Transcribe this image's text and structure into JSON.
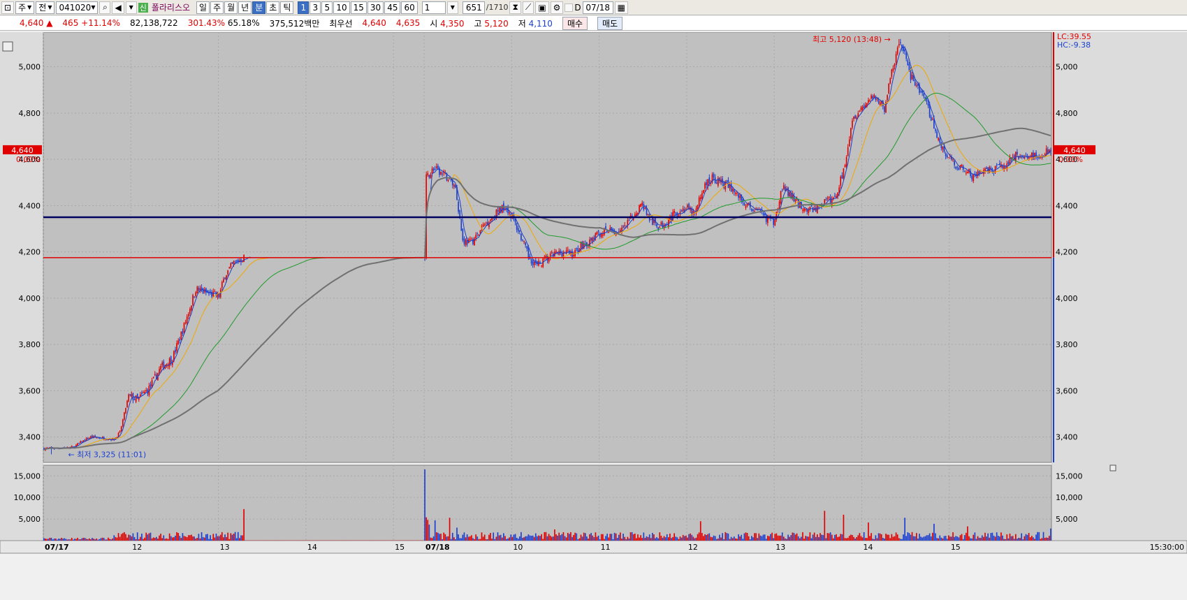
{
  "toolbar": {
    "type_label": "주",
    "all_label": "전",
    "code": "041020",
    "new_badge": "신",
    "stock_name": "폴라리스오",
    "periods": [
      "일",
      "주",
      "월",
      "년",
      "분",
      "초",
      "틱"
    ],
    "selected_period": "분",
    "intervals": [
      "1",
      "3",
      "5",
      "10",
      "15",
      "30",
      "45",
      "60"
    ],
    "selected_interval": "1",
    "interval_value": "1",
    "count": "651",
    "count_total": "/1710",
    "date_prefix": "D",
    "date": "07/18"
  },
  "quote": {
    "price": "4,640",
    "change": "465",
    "change_pct": "+11.14%",
    "volume": "82,138,722",
    "vol_ratio": "301.43%",
    "turnover": "65.18%",
    "amount": "375,512백만",
    "best_label": "최우선",
    "ask": "4,640",
    "bid": "4,635",
    "open_label": "시",
    "open": "4,350",
    "high_label": "고",
    "high": "5,120",
    "low_label": "저",
    "low": "4,110",
    "buy_label": "매수",
    "sell_label": "매도"
  },
  "colors": {
    "up": "#e10000",
    "down": "#1a3fd1",
    "ma5": "#1c3cc4",
    "ma20": "#f0a800",
    "ma60": "#1f9a2a",
    "ma120": "#707070",
    "navy_line": "#000060",
    "red_line": "#e00000",
    "plot_bg": "#c0c0c0"
  },
  "chart_data": {
    "type": "candlestick",
    "price_axis": {
      "min": 3290,
      "max": 5150,
      "ticks": [
        3400,
        3600,
        3800,
        4000,
        4200,
        4400,
        4600,
        4800,
        5000
      ],
      "tick_labels": [
        "3,400",
        "3,600",
        "3,800",
        "4,000",
        "4,200",
        "4,400",
        "4,600",
        "4,800",
        "5,000"
      ]
    },
    "volume_axis": {
      "min": 0,
      "max": 16500,
      "ticks": [
        5000,
        10000,
        15000
      ],
      "tick_labels": [
        "5,000",
        "10,000",
        "15,000"
      ]
    },
    "time_labels": [
      {
        "idx": 0,
        "text": "07/17"
      },
      {
        "idx": 60,
        "text": "12"
      },
      {
        "idx": 120,
        "text": "13"
      },
      {
        "idx": 180,
        "text": "14"
      },
      {
        "idx": 240,
        "text": "15"
      },
      {
        "idx": 261,
        "text": "07/18"
      },
      {
        "idx": 321,
        "text": "10"
      },
      {
        "idx": 381,
        "text": "11"
      },
      {
        "idx": 441,
        "text": "12"
      },
      {
        "idx": 501,
        "text": "13"
      },
      {
        "idx": 561,
        "text": "14"
      },
      {
        "idx": 621,
        "text": "15"
      }
    ],
    "end_time_label": "15:30:00",
    "keypoints": [
      [
        0,
        3350
      ],
      [
        20,
        3355
      ],
      [
        26,
        3380
      ],
      [
        32,
        3400
      ],
      [
        48,
        3390
      ],
      [
        52,
        3420
      ],
      [
        58,
        3580
      ],
      [
        64,
        3560
      ],
      [
        72,
        3610
      ],
      [
        80,
        3700
      ],
      [
        88,
        3740
      ],
      [
        96,
        3880
      ],
      [
        104,
        4040
      ],
      [
        112,
        4020
      ],
      [
        120,
        4010
      ],
      [
        124,
        4100
      ],
      [
        130,
        4150
      ],
      [
        137,
        4175
      ],
      [
        261,
        4175
      ],
      [
        262,
        4520
      ],
      [
        267,
        4560
      ],
      [
        272,
        4540
      ],
      [
        277,
        4520
      ],
      [
        282,
        4480
      ],
      [
        287,
        4250
      ],
      [
        292,
        4240
      ],
      [
        297,
        4270
      ],
      [
        302,
        4320
      ],
      [
        307,
        4350
      ],
      [
        312,
        4380
      ],
      [
        316,
        4400
      ],
      [
        320,
        4360
      ],
      [
        326,
        4280
      ],
      [
        332,
        4180
      ],
      [
        338,
        4140
      ],
      [
        344,
        4170
      ],
      [
        350,
        4190
      ],
      [
        356,
        4200
      ],
      [
        363,
        4190
      ],
      [
        368,
        4230
      ],
      [
        374,
        4240
      ],
      [
        380,
        4280
      ],
      [
        386,
        4290
      ],
      [
        392,
        4285
      ],
      [
        398,
        4300
      ],
      [
        404,
        4360
      ],
      [
        410,
        4410
      ],
      [
        416,
        4330
      ],
      [
        422,
        4310
      ],
      [
        428,
        4340
      ],
      [
        434,
        4370
      ],
      [
        440,
        4390
      ],
      [
        446,
        4360
      ],
      [
        452,
        4480
      ],
      [
        458,
        4520
      ],
      [
        464,
        4500
      ],
      [
        470,
        4480
      ],
      [
        476,
        4440
      ],
      [
        482,
        4400
      ],
      [
        488,
        4380
      ],
      [
        494,
        4350
      ],
      [
        500,
        4330
      ],
      [
        506,
        4480
      ],
      [
        512,
        4440
      ],
      [
        518,
        4400
      ],
      [
        524,
        4380
      ],
      [
        530,
        4390
      ],
      [
        536,
        4420
      ],
      [
        542,
        4430
      ],
      [
        548,
        4550
      ],
      [
        554,
        4780
      ],
      [
        560,
        4820
      ],
      [
        566,
        4860
      ],
      [
        572,
        4860
      ],
      [
        576,
        4820
      ],
      [
        580,
        4950
      ],
      [
        586,
        5100
      ],
      [
        590,
        5060
      ],
      [
        594,
        4960
      ],
      [
        600,
        4900
      ],
      [
        606,
        4820
      ],
      [
        612,
        4700
      ],
      [
        618,
        4620
      ],
      [
        624,
        4580
      ],
      [
        630,
        4560
      ],
      [
        636,
        4530
      ],
      [
        642,
        4540
      ],
      [
        648,
        4550
      ],
      [
        654,
        4560
      ],
      [
        660,
        4580
      ],
      [
        666,
        4620
      ],
      [
        672,
        4610
      ],
      [
        680,
        4615
      ],
      [
        690,
        4640
      ]
    ],
    "period_start_idx": 261,
    "n_bars": 691,
    "high_marker": {
      "label": "최고 5,120 (13:48)",
      "value": 5120,
      "idx": 586
    },
    "low_marker": {
      "label": "최저 3,325 (11:01)",
      "value": 3325,
      "idx": 5
    },
    "current": {
      "price": "4,640",
      "value": 4640,
      "change_text": "0.00%"
    },
    "reference_lines": [
      {
        "value": 4350,
        "color": "navy"
      },
      {
        "value": 4175,
        "color": "red"
      }
    ],
    "moving_averages": [
      {
        "period": 5,
        "color_key": "ma5"
      },
      {
        "period": 20,
        "color_key": "ma20"
      },
      {
        "period": 60,
        "color_key": "ma60"
      },
      {
        "period": 120,
        "color_key": "ma120"
      }
    ],
    "lc_label": "LC:39.55",
    "hc_label": "HC:-9.38",
    "volume_spikes": [
      [
        137,
        7300
      ],
      [
        261,
        16500
      ],
      [
        262,
        5400
      ],
      [
        263,
        4800
      ],
      [
        264,
        3700
      ],
      [
        268,
        4700
      ],
      [
        278,
        5300
      ],
      [
        283,
        3000
      ],
      [
        350,
        2600
      ],
      [
        450,
        4500
      ],
      [
        535,
        6900
      ],
      [
        548,
        6000
      ],
      [
        565,
        4200
      ],
      [
        590,
        5300
      ],
      [
        610,
        3900
      ],
      [
        633,
        3300
      ],
      [
        690,
        2800
      ]
    ]
  }
}
